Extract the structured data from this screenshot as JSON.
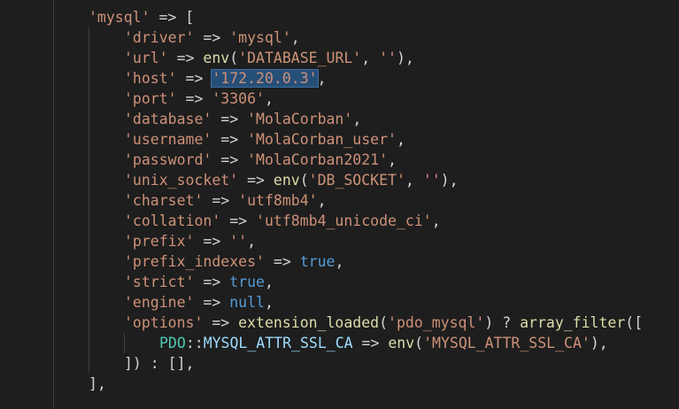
{
  "editor": {
    "lines": [
      {
        "indent": 100,
        "tokens": [
          {
            "t": "'mysql'",
            "c": "str"
          },
          {
            "t": " => [",
            "c": "op"
          }
        ]
      },
      {
        "indent": 140,
        "tokens": [
          {
            "t": "'driver'",
            "c": "str"
          },
          {
            "t": " => ",
            "c": "op"
          },
          {
            "t": "'mysql'",
            "c": "str"
          },
          {
            "t": ",",
            "c": "op"
          }
        ]
      },
      {
        "indent": 140,
        "tokens": [
          {
            "t": "'url'",
            "c": "str"
          },
          {
            "t": " => ",
            "c": "op"
          },
          {
            "t": "env",
            "c": "fn"
          },
          {
            "t": "(",
            "c": "op"
          },
          {
            "t": "'DATABASE_URL'",
            "c": "str"
          },
          {
            "t": ", ",
            "c": "op"
          },
          {
            "t": "''",
            "c": "str"
          },
          {
            "t": "),",
            "c": "op"
          }
        ]
      },
      {
        "indent": 140,
        "tokens": [
          {
            "t": "'host'",
            "c": "str"
          },
          {
            "t": " => ",
            "c": "op"
          },
          {
            "t": "'172.20.0.3'",
            "c": "str",
            "sel": true
          },
          {
            "t": ",",
            "c": "op"
          }
        ]
      },
      {
        "indent": 140,
        "tokens": [
          {
            "t": "'port'",
            "c": "str"
          },
          {
            "t": " => ",
            "c": "op"
          },
          {
            "t": "'3306'",
            "c": "str"
          },
          {
            "t": ",",
            "c": "op"
          }
        ]
      },
      {
        "indent": 140,
        "tokens": [
          {
            "t": "'database'",
            "c": "str"
          },
          {
            "t": " => ",
            "c": "op"
          },
          {
            "t": "'MolaCorban'",
            "c": "str"
          },
          {
            "t": ",",
            "c": "op"
          }
        ]
      },
      {
        "indent": 140,
        "tokens": [
          {
            "t": "'username'",
            "c": "str"
          },
          {
            "t": " => ",
            "c": "op"
          },
          {
            "t": "'MolaCorban_user'",
            "c": "str"
          },
          {
            "t": ",",
            "c": "op"
          }
        ]
      },
      {
        "indent": 140,
        "tokens": [
          {
            "t": "'password'",
            "c": "str"
          },
          {
            "t": " => ",
            "c": "op"
          },
          {
            "t": "'MolaCorban2021'",
            "c": "str"
          },
          {
            "t": ",",
            "c": "op"
          }
        ]
      },
      {
        "indent": 140,
        "tokens": [
          {
            "t": "'unix_socket'",
            "c": "str"
          },
          {
            "t": " => ",
            "c": "op"
          },
          {
            "t": "env",
            "c": "fn"
          },
          {
            "t": "(",
            "c": "op"
          },
          {
            "t": "'DB_SOCKET'",
            "c": "str"
          },
          {
            "t": ", ",
            "c": "op"
          },
          {
            "t": "''",
            "c": "str"
          },
          {
            "t": "),",
            "c": "op"
          }
        ]
      },
      {
        "indent": 140,
        "tokens": [
          {
            "t": "'charset'",
            "c": "str"
          },
          {
            "t": " => ",
            "c": "op"
          },
          {
            "t": "'utf8mb4'",
            "c": "str"
          },
          {
            "t": ",",
            "c": "op"
          }
        ]
      },
      {
        "indent": 140,
        "tokens": [
          {
            "t": "'collation'",
            "c": "str"
          },
          {
            "t": " => ",
            "c": "op"
          },
          {
            "t": "'utf8mb4_unicode_ci'",
            "c": "str"
          },
          {
            "t": ",",
            "c": "op"
          }
        ]
      },
      {
        "indent": 140,
        "tokens": [
          {
            "t": "'prefix'",
            "c": "str"
          },
          {
            "t": " => ",
            "c": "op"
          },
          {
            "t": "''",
            "c": "str"
          },
          {
            "t": ",",
            "c": "op"
          }
        ]
      },
      {
        "indent": 140,
        "tokens": [
          {
            "t": "'prefix_indexes'",
            "c": "str"
          },
          {
            "t": " => ",
            "c": "op"
          },
          {
            "t": "true",
            "c": "kw"
          },
          {
            "t": ",",
            "c": "op"
          }
        ]
      },
      {
        "indent": 140,
        "tokens": [
          {
            "t": "'strict'",
            "c": "str"
          },
          {
            "t": " => ",
            "c": "op"
          },
          {
            "t": "true",
            "c": "kw"
          },
          {
            "t": ",",
            "c": "op"
          }
        ]
      },
      {
        "indent": 140,
        "tokens": [
          {
            "t": "'engine'",
            "c": "str"
          },
          {
            "t": " => ",
            "c": "op"
          },
          {
            "t": "null",
            "c": "kw"
          },
          {
            "t": ",",
            "c": "op"
          }
        ]
      },
      {
        "indent": 140,
        "tokens": [
          {
            "t": "'options'",
            "c": "str"
          },
          {
            "t": " => ",
            "c": "op"
          },
          {
            "t": "extension_loaded",
            "c": "fn"
          },
          {
            "t": "(",
            "c": "op"
          },
          {
            "t": "'pdo_mysql'",
            "c": "str"
          },
          {
            "t": ") ? ",
            "c": "op"
          },
          {
            "t": "array_filter",
            "c": "fn"
          },
          {
            "t": "([",
            "c": "op"
          }
        ]
      },
      {
        "indent": 180,
        "tokens": [
          {
            "t": "PDO",
            "c": "cls"
          },
          {
            "t": "::",
            "c": "op"
          },
          {
            "t": "MYSQL_ATTR_SSL_CA",
            "c": "con"
          },
          {
            "t": " => ",
            "c": "op"
          },
          {
            "t": "env",
            "c": "fn"
          },
          {
            "t": "(",
            "c": "op"
          },
          {
            "t": "'MYSQL_ATTR_SSL_CA'",
            "c": "str"
          },
          {
            "t": "),",
            "c": "op"
          }
        ]
      },
      {
        "indent": 140,
        "tokens": [
          {
            "t": "]) : [],",
            "c": "op"
          }
        ]
      },
      {
        "indent": 100,
        "tokens": [
          {
            "t": "],",
            "c": "op"
          }
        ]
      }
    ]
  }
}
